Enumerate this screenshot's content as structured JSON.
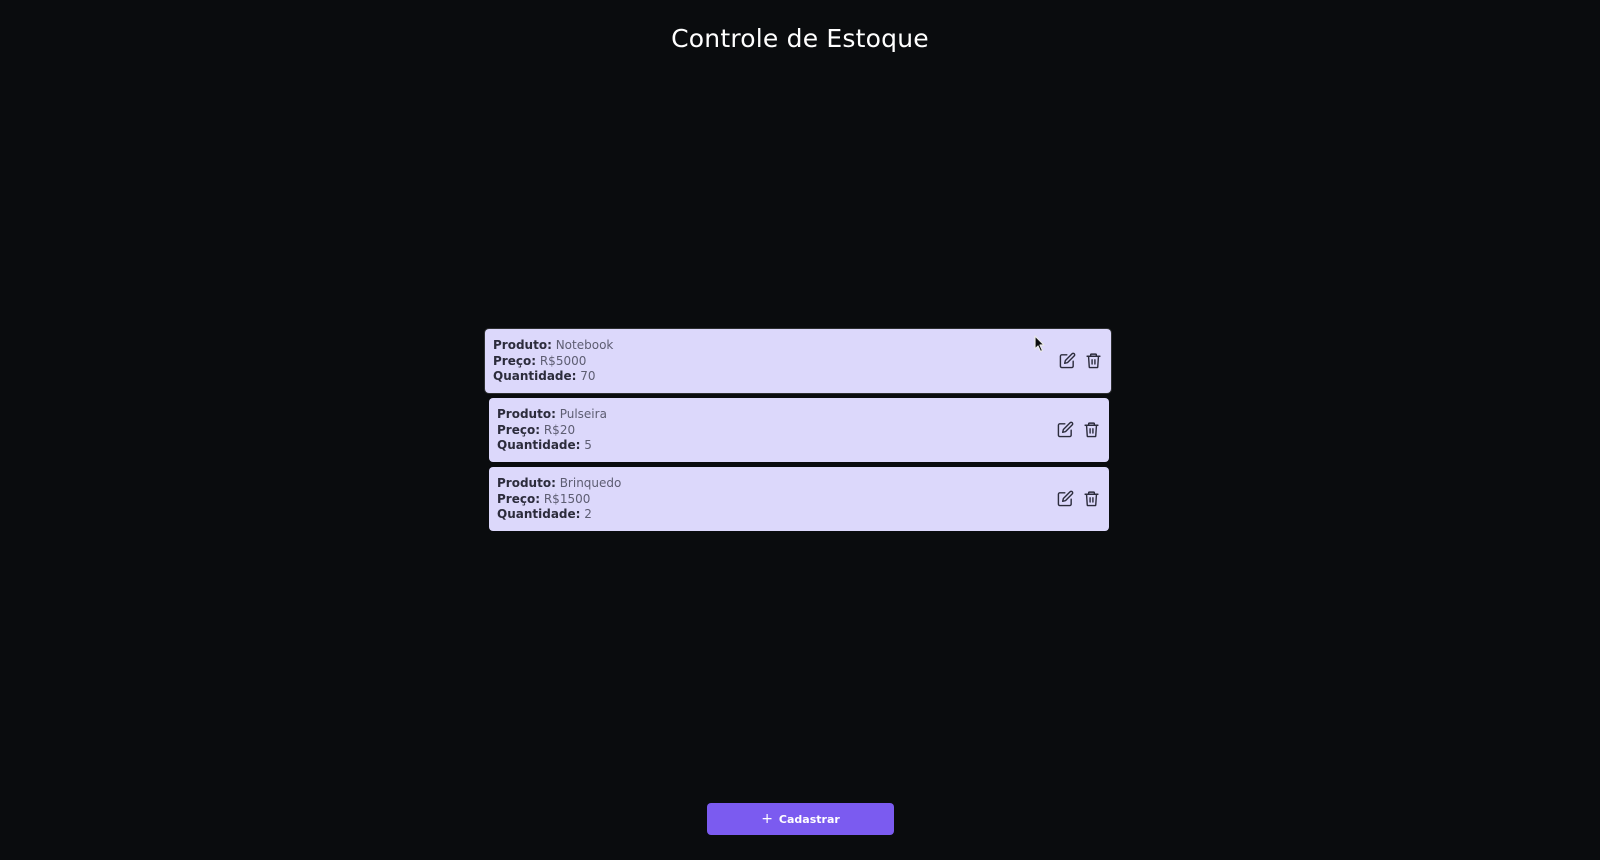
{
  "header": {
    "title": "Controle de Estoque"
  },
  "products": [
    {
      "product_label": "Produto:",
      "product_value": "Notebook",
      "price_label": "Preço:",
      "price_value": "R$5000",
      "quantity_label": "Quantidade:",
      "quantity_value": "70"
    },
    {
      "product_label": "Produto:",
      "product_value": "Pulseira",
      "price_label": "Preço:",
      "price_value": "R$20",
      "quantity_label": "Quantidade:",
      "quantity_value": "5"
    },
    {
      "product_label": "Produto:",
      "product_value": "Brinquedo",
      "price_label": "Preço:",
      "price_value": "R$1500",
      "quantity_label": "Quantidade:",
      "quantity_value": "2"
    }
  ],
  "icons": {
    "edit": "edit-icon",
    "delete": "trash-icon",
    "add": "plus-icon",
    "pointer": "mouse-cursor-icon"
  },
  "footer": {
    "register_icon": "+",
    "register_label": "Cadastrar"
  },
  "colors": {
    "background": "#0a0c0e",
    "card": "#dcd8fb",
    "accent": "#7b5bf0",
    "title": "#ffffff"
  }
}
